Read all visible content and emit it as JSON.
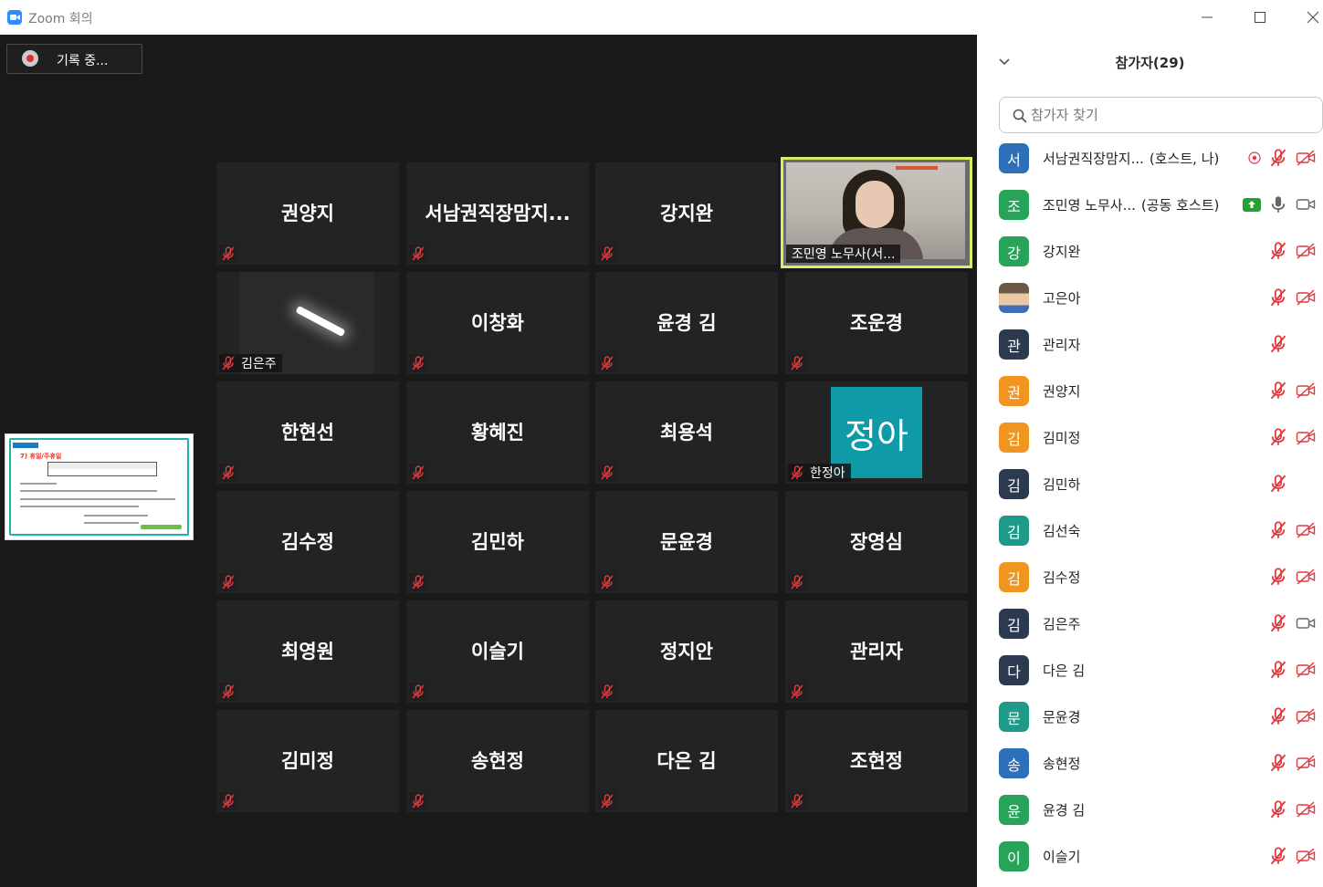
{
  "window": {
    "title": "Zoom 회의"
  },
  "recording": {
    "label": "기록 중..."
  },
  "share_thumbnail": {
    "heading": "7) 휴일/주휴일"
  },
  "tiles": [
    {
      "name": "권양지",
      "kind": "name"
    },
    {
      "name": "서남권직장맘지...",
      "kind": "name"
    },
    {
      "name": "강지완",
      "kind": "name"
    },
    {
      "name": "조민영 노무사(서...",
      "kind": "camera"
    },
    {
      "name": "김은주",
      "kind": "dark"
    },
    {
      "name": "이창화",
      "kind": "name"
    },
    {
      "name": "윤경 김",
      "kind": "name"
    },
    {
      "name": "조운경",
      "kind": "name"
    },
    {
      "name": "한현선",
      "kind": "name"
    },
    {
      "name": "황혜진",
      "kind": "name"
    },
    {
      "name": "최용석",
      "kind": "name"
    },
    {
      "name": "한정아",
      "kind": "avatar",
      "avatar_text": "정아"
    },
    {
      "name": "김수정",
      "kind": "name"
    },
    {
      "name": "김민하",
      "kind": "name"
    },
    {
      "name": "문윤경",
      "kind": "name"
    },
    {
      "name": "장영심",
      "kind": "name"
    },
    {
      "name": "최영원",
      "kind": "name"
    },
    {
      "name": "이슬기",
      "kind": "name"
    },
    {
      "name": "정지안",
      "kind": "name"
    },
    {
      "name": "관리자",
      "kind": "name"
    },
    {
      "name": "김미정",
      "kind": "name"
    },
    {
      "name": "송현정",
      "kind": "name"
    },
    {
      "name": "다은 김",
      "kind": "name"
    },
    {
      "name": "조현정",
      "kind": "name"
    }
  ],
  "panel": {
    "title": "참가자(29)",
    "search_placeholder": "참가자 찾기",
    "participants": [
      {
        "initial": "서",
        "name": "서남권직장맘지...",
        "tag": "(호스트, 나)",
        "color": "#2d6fb9",
        "rec": true,
        "share": false,
        "mic": "muted",
        "video": "off"
      },
      {
        "initial": "조",
        "name": "조민영 노무사...",
        "tag": "(공동 호스트)",
        "color": "#27a35a",
        "rec": false,
        "share": true,
        "mic": "on",
        "video": "on"
      },
      {
        "initial": "강",
        "name": "강지완",
        "tag": "",
        "color": "#27a35a",
        "rec": false,
        "share": false,
        "mic": "muted",
        "video": "off"
      },
      {
        "initial": "",
        "name": "고은아",
        "tag": "",
        "color": "#8a7a66",
        "rec": false,
        "share": false,
        "mic": "muted",
        "video": "off",
        "photo": true
      },
      {
        "initial": "관",
        "name": "관리자",
        "tag": "",
        "color": "#2b3a4e",
        "rec": false,
        "share": false,
        "mic": "muted",
        "video": "none"
      },
      {
        "initial": "권",
        "name": "권양지",
        "tag": "",
        "color": "#f0951f",
        "rec": false,
        "share": false,
        "mic": "muted",
        "video": "off"
      },
      {
        "initial": "김",
        "name": "김미정",
        "tag": "",
        "color": "#f0951f",
        "rec": false,
        "share": false,
        "mic": "muted",
        "video": "off"
      },
      {
        "initial": "김",
        "name": "김민하",
        "tag": "",
        "color": "#2b3a4e",
        "rec": false,
        "share": false,
        "mic": "muted",
        "video": "none"
      },
      {
        "initial": "김",
        "name": "김선숙",
        "tag": "",
        "color": "#1f9a88",
        "rec": false,
        "share": false,
        "mic": "muted",
        "video": "off"
      },
      {
        "initial": "김",
        "name": "김수정",
        "tag": "",
        "color": "#f0951f",
        "rec": false,
        "share": false,
        "mic": "muted",
        "video": "off"
      },
      {
        "initial": "김",
        "name": "김은주",
        "tag": "",
        "color": "#2b3a4e",
        "rec": false,
        "share": false,
        "mic": "muted",
        "video": "on"
      },
      {
        "initial": "다",
        "name": "다은 김",
        "tag": "",
        "color": "#2b3a4e",
        "rec": false,
        "share": false,
        "mic": "muted",
        "video": "off"
      },
      {
        "initial": "문",
        "name": "문윤경",
        "tag": "",
        "color": "#1f9a88",
        "rec": false,
        "share": false,
        "mic": "muted",
        "video": "off"
      },
      {
        "initial": "송",
        "name": "송현정",
        "tag": "",
        "color": "#2d6fb9",
        "rec": false,
        "share": false,
        "mic": "muted",
        "video": "off"
      },
      {
        "initial": "윤",
        "name": "윤경 김",
        "tag": "",
        "color": "#27a35a",
        "rec": false,
        "share": false,
        "mic": "muted",
        "video": "off"
      },
      {
        "initial": "이",
        "name": "이슬기",
        "tag": "",
        "color": "#27a35a",
        "rec": false,
        "share": false,
        "mic": "muted",
        "video": "off"
      }
    ]
  },
  "colors": {
    "muted_icon": "#e0393e",
    "active_speaker": "#d4f06a",
    "recording_dot": "#e02f2f"
  }
}
